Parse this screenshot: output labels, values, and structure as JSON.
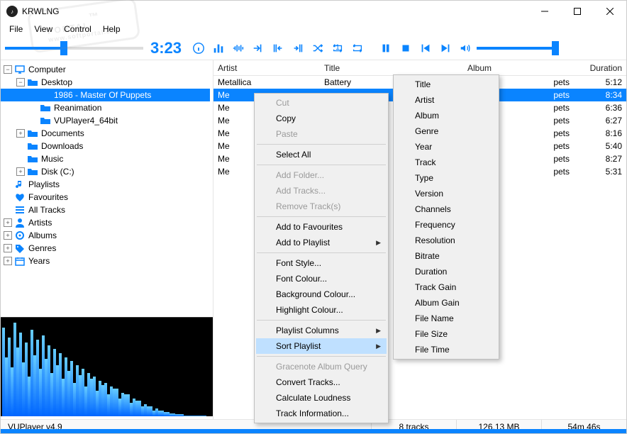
{
  "window": {
    "title": "KRWLNG"
  },
  "menu": [
    "File",
    "View",
    "Control",
    "Help"
  ],
  "player": {
    "time": "3:23",
    "seek_pct": 40,
    "vol_pct": 96
  },
  "tree": [
    {
      "depth": 0,
      "exp": "-",
      "icon": "pc",
      "label": "Computer"
    },
    {
      "depth": 1,
      "exp": "-",
      "icon": "folder",
      "label": "Desktop"
    },
    {
      "depth": 2,
      "exp": " ",
      "icon": "folder",
      "label": "1986 - Master Of Puppets",
      "selected": true
    },
    {
      "depth": 2,
      "exp": " ",
      "icon": "folder",
      "label": "Reanimation"
    },
    {
      "depth": 2,
      "exp": " ",
      "icon": "folder",
      "label": "VUPlayer4_64bit"
    },
    {
      "depth": 1,
      "exp": "+",
      "icon": "folder",
      "label": "Documents"
    },
    {
      "depth": 1,
      "exp": " ",
      "icon": "folder",
      "label": "Downloads"
    },
    {
      "depth": 1,
      "exp": " ",
      "icon": "folder",
      "label": "Music"
    },
    {
      "depth": 1,
      "exp": "+",
      "icon": "folder",
      "label": "Disk (C:)"
    },
    {
      "depth": 0,
      "exp": " ",
      "icon": "note",
      "label": "Playlists"
    },
    {
      "depth": 0,
      "exp": " ",
      "icon": "heart",
      "label": "Favourites"
    },
    {
      "depth": 0,
      "exp": " ",
      "icon": "list",
      "label": "All Tracks"
    },
    {
      "depth": 0,
      "exp": "+",
      "icon": "person",
      "label": "Artists"
    },
    {
      "depth": 0,
      "exp": "+",
      "icon": "disc",
      "label": "Albums"
    },
    {
      "depth": 0,
      "exp": "+",
      "icon": "tag",
      "label": "Genres"
    },
    {
      "depth": 0,
      "exp": "+",
      "icon": "cal",
      "label": "Years"
    }
  ],
  "columns": {
    "artist": "Artist",
    "title": "Title",
    "album": "Album",
    "duration": "Duration"
  },
  "tracks": [
    {
      "artist": "Metallica",
      "title": "Battery",
      "album_suffix": "pets",
      "duration": "5:12"
    },
    {
      "artist": "Me",
      "title": "",
      "album_suffix": "pets",
      "duration": "8:34",
      "selected": true
    },
    {
      "artist": "Me",
      "title": "",
      "album_suffix": "pets",
      "duration": "6:36"
    },
    {
      "artist": "Me",
      "title": "",
      "album_suffix": "pets",
      "duration": "6:27"
    },
    {
      "artist": "Me",
      "title": "",
      "album_suffix": "pets",
      "duration": "8:16"
    },
    {
      "artist": "Me",
      "title": "",
      "album_suffix": "pets",
      "duration": "5:40"
    },
    {
      "artist": "Me",
      "title": "",
      "album_suffix": "pets",
      "duration": "8:27"
    },
    {
      "artist": "Me",
      "title": "",
      "album_suffix": "pets",
      "duration": "5:31"
    }
  ],
  "context_menu": [
    {
      "label": "Cut",
      "disabled": true
    },
    {
      "label": "Copy"
    },
    {
      "label": "Paste",
      "disabled": true
    },
    {
      "sep": true
    },
    {
      "label": "Select All"
    },
    {
      "sep": true
    },
    {
      "label": "Add Folder...",
      "disabled": true
    },
    {
      "label": "Add Tracks...",
      "disabled": true
    },
    {
      "label": "Remove Track(s)",
      "disabled": true
    },
    {
      "sep": true
    },
    {
      "label": "Add to Favourites"
    },
    {
      "label": "Add to Playlist",
      "submenu": true
    },
    {
      "sep": true
    },
    {
      "label": "Font Style..."
    },
    {
      "label": "Font Colour..."
    },
    {
      "label": "Background Colour..."
    },
    {
      "label": "Highlight Colour..."
    },
    {
      "sep": true
    },
    {
      "label": "Playlist Columns",
      "submenu": true
    },
    {
      "label": "Sort Playlist",
      "submenu": true,
      "hover": true
    },
    {
      "sep": true
    },
    {
      "label": "Gracenote Album Query",
      "disabled": true
    },
    {
      "label": "Convert Tracks..."
    },
    {
      "label": "Calculate Loudness"
    },
    {
      "label": "Track Information..."
    }
  ],
  "sort_submenu": [
    "Title",
    "Artist",
    "Album",
    "Genre",
    "Year",
    "Track",
    "Type",
    "Version",
    "Channels",
    "Frequency",
    "Resolution",
    "Bitrate",
    "Duration",
    "Track Gain",
    "Album Gain",
    "File Name",
    "File Size",
    "File Time"
  ],
  "status": {
    "version": "VUPlayer v4.9",
    "tracks": "8 tracks",
    "size": "126.13 MB",
    "time": "54m 46s"
  },
  "watermark": {
    "main": "PORTAL",
    "sub": "www.softportal.com"
  }
}
